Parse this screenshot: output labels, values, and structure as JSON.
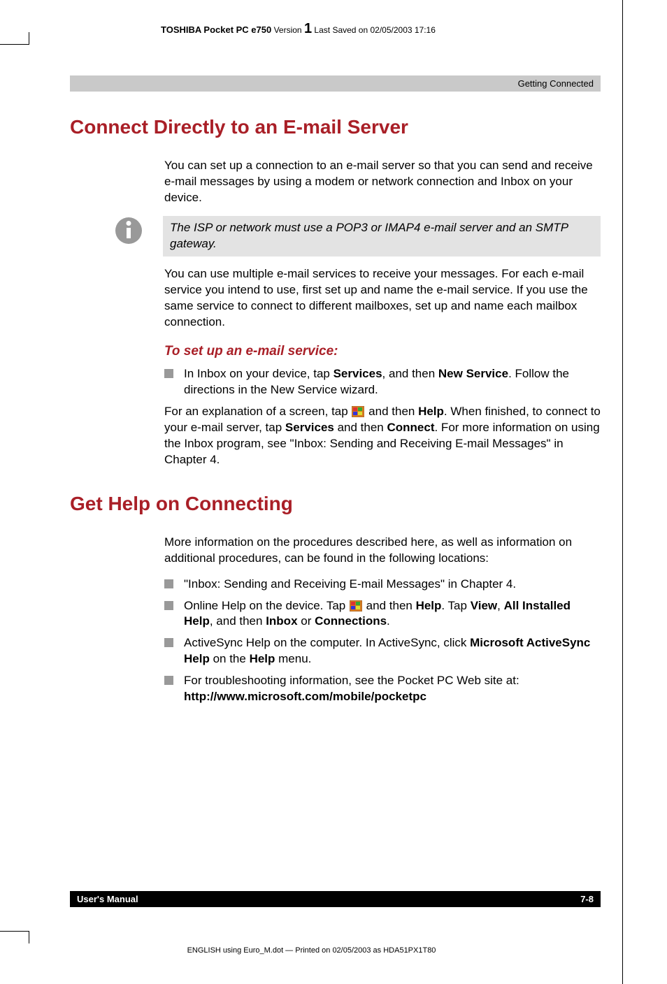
{
  "header": {
    "product": "TOSHIBA Pocket PC e750",
    "version_label": "Version",
    "version_num": "1",
    "saved": "Last Saved on 02/05/2003 17:16"
  },
  "section_bar": "Getting Connected",
  "sec1": {
    "title": "Connect Directly to an E-mail Server",
    "p1": "You can set up a connection to an e-mail server so that you can send and receive e-mail messages by using a modem or network connection and Inbox on your device.",
    "callout": "The ISP or network must use a POP3 or IMAP4 e-mail server and an SMTP gateway.",
    "p2": "You can use multiple e-mail services to receive your messages. For each e-mail service you intend to use, first set up and name the e-mail service. If you use the same service to connect to different mailboxes, set up and name each mailbox connection.",
    "sub_title": "To set up an e-mail service:",
    "li1_a": "In Inbox on your device, tap ",
    "li1_b": "Services",
    "li1_c": ", and then ",
    "li1_d": "New Service",
    "li1_e": ". Follow the directions in the New Service wizard.",
    "p3_a": "For an explanation of a screen, tap ",
    "p3_b": " and then ",
    "p3_c": "Help",
    "p3_d": ". When finished, to connect to your e-mail server, tap ",
    "p3_e": "Services",
    "p3_f": " and then ",
    "p3_g": "Connect",
    "p3_h": ". For more information on using the Inbox program, see \"Inbox: Sending and Receiving E-mail Messages\" in Chapter 4."
  },
  "sec2": {
    "title": "Get Help on Connecting",
    "p1": "More information on the procedures described here, as well as information on additional procedures, can be found in the following locations:",
    "li1": "\"Inbox: Sending and Receiving E-mail Messages\" in Chapter 4.",
    "li2_a": "Online Help on the device. Tap ",
    "li2_b": " and then ",
    "li2_c": "Help",
    "li2_d": ". Tap ",
    "li2_e": "View",
    "li2_f": ", ",
    "li2_g": "All Installed Help",
    "li2_h": ", and then ",
    "li2_i": "Inbox",
    "li2_j": " or ",
    "li2_k": "Connections",
    "li2_l": ".",
    "li3_a": "ActiveSync Help on the computer. In ActiveSync, click ",
    "li3_b": "Microsoft ActiveSync Help",
    "li3_c": " on the ",
    "li3_d": "Help",
    "li3_e": " menu.",
    "li4_a": "For troubleshooting information, see the Pocket PC Web site at: ",
    "li4_b": "http://www.microsoft.com/mobile/pocketpc"
  },
  "footer": {
    "left": "User's Manual",
    "right": "7-8"
  },
  "print_line": "ENGLISH using Euro_M.dot — Printed on 02/05/2003 as HDA51PX1T80"
}
